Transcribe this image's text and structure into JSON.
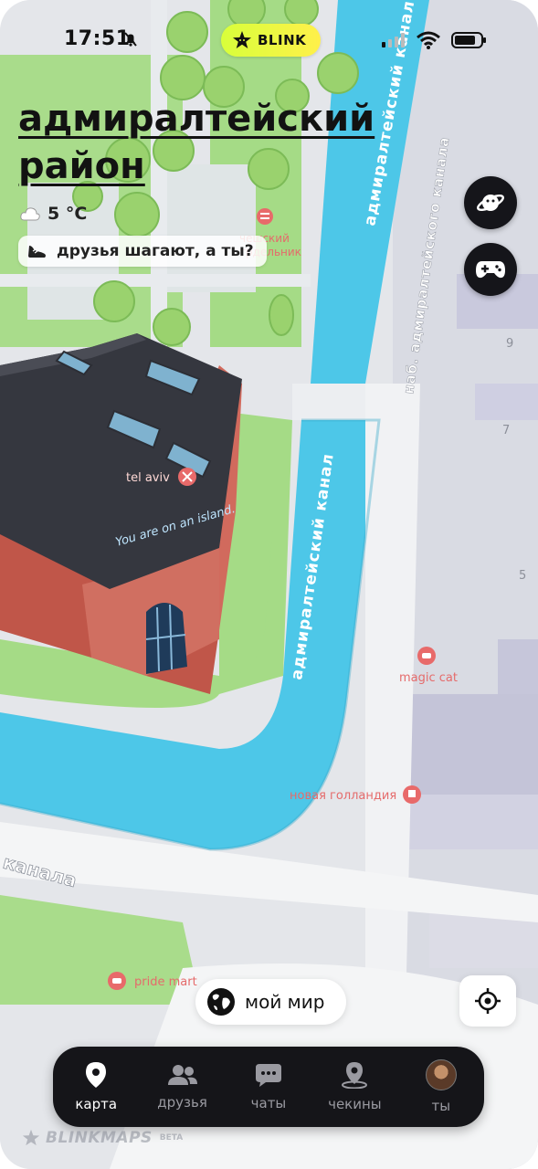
{
  "status": {
    "time": "17:51",
    "app_badge": "BLINK"
  },
  "header": {
    "district": "адмиралтейский район",
    "weather_temp": "5 °C",
    "friends_prompt": "друзья шагают, а ты?"
  },
  "map": {
    "streets": {
      "admiralteysky_canal_top": "адмиралтейский канал",
      "admiralteysky_canal_mid": "адмиралтейский канал",
      "embankment": "наб. адмиралтейского канала",
      "kanala_left": "канала"
    },
    "places": {
      "trdelnik": "чешский трдельник",
      "tel_aviv": "tel aviv",
      "magic_cat": "magic cat",
      "new_holland": "новая голландия",
      "pride_mart": "pride mart"
    },
    "building_sign": "You are on an island.",
    "house_numbers": [
      "9",
      "7",
      "5"
    ]
  },
  "my_world": {
    "label": "мой мир"
  },
  "nav": {
    "items": [
      {
        "label": "карта",
        "icon": "map-pin-icon",
        "active": true
      },
      {
        "label": "друзья",
        "icon": "friends-icon",
        "active": false
      },
      {
        "label": "чаты",
        "icon": "chat-icon",
        "active": false
      },
      {
        "label": "чекины",
        "icon": "checkin-icon",
        "active": false
      },
      {
        "label": "ты",
        "icon": "avatar",
        "active": false
      }
    ]
  },
  "watermark": {
    "brand": "BLINKMAPS",
    "tag": "BETA"
  },
  "colors": {
    "water": "#4dc7e8",
    "grass": "#9fd981",
    "building_roof": "#35373f",
    "brick": "#c25a4e",
    "poi": "#e85a5a",
    "accent": "#e2ff3d"
  }
}
